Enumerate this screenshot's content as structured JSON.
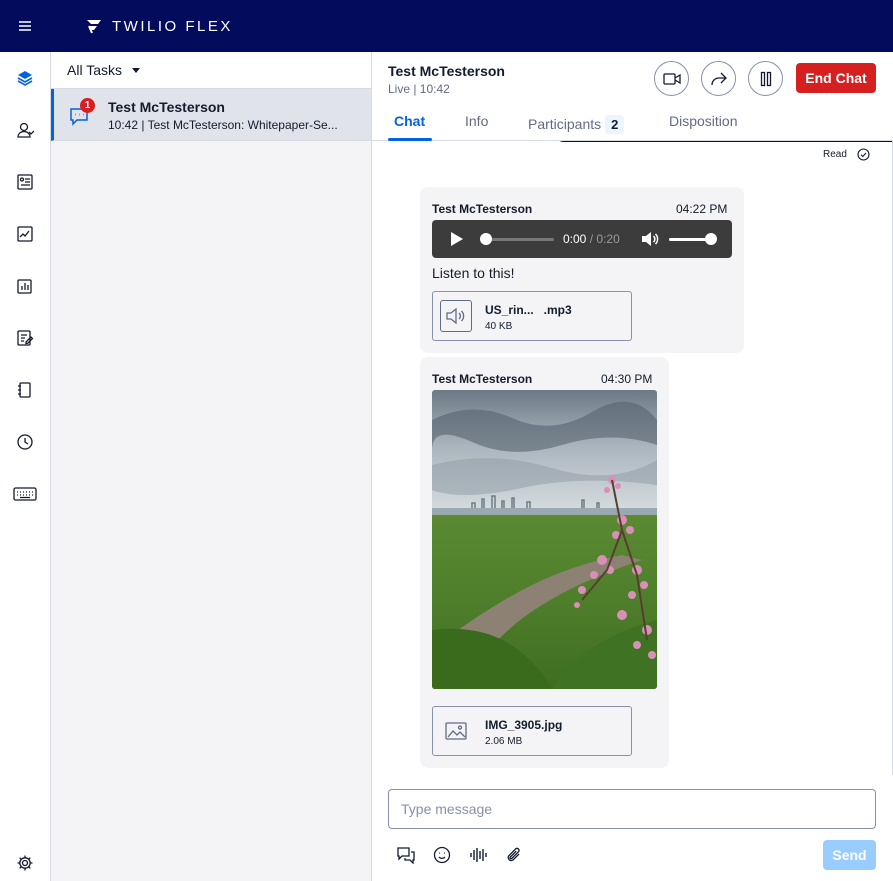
{
  "topbar": {
    "brand": "TWILIO FLEX"
  },
  "nav": {
    "icons": [
      "layers-icon",
      "agents-icon",
      "queues-icon",
      "analytics-icon",
      "dashboards-icon",
      "questionnaire-icon",
      "directory-icon",
      "history-icon",
      "keyboard-icon",
      "settings-icon"
    ]
  },
  "tasks": {
    "filter_label": "All Tasks",
    "items": [
      {
        "badge": "1",
        "name": "Test McTesterson",
        "summary": "10:42 | Test McTesterson: Whitepaper-Se..."
      }
    ]
  },
  "conversation": {
    "customer_name": "Test McTesterson",
    "status": "Live | 10:42",
    "end_label": "End Chat",
    "tabs": [
      {
        "label": "Chat"
      },
      {
        "label": "Info"
      },
      {
        "label": "Participants",
        "count": "2"
      },
      {
        "label": "Disposition"
      }
    ],
    "read_label": "Read",
    "messages": [
      {
        "author": "Test McTesterson",
        "time": "04:22 PM",
        "audio": {
          "current": "0:00",
          "separator": "/",
          "duration": "0:20",
          "progress": 0,
          "volume": 1
        },
        "text": "Listen to this!",
        "attachment": {
          "name": "US_rin...   .mp3",
          "size": "40 KB"
        }
      },
      {
        "author": "Test McTesterson",
        "time": "04:30 PM",
        "attachment": {
          "name": "IMG_3905.jpg",
          "size": "2.06 MB"
        }
      }
    ]
  },
  "composer": {
    "placeholder": "Type message",
    "send_label": "Send"
  },
  "colors": {
    "topbar": "#030b5d",
    "accent": "#0263e0",
    "danger": "#d61f1f",
    "send_disabled": "#99cdff"
  }
}
